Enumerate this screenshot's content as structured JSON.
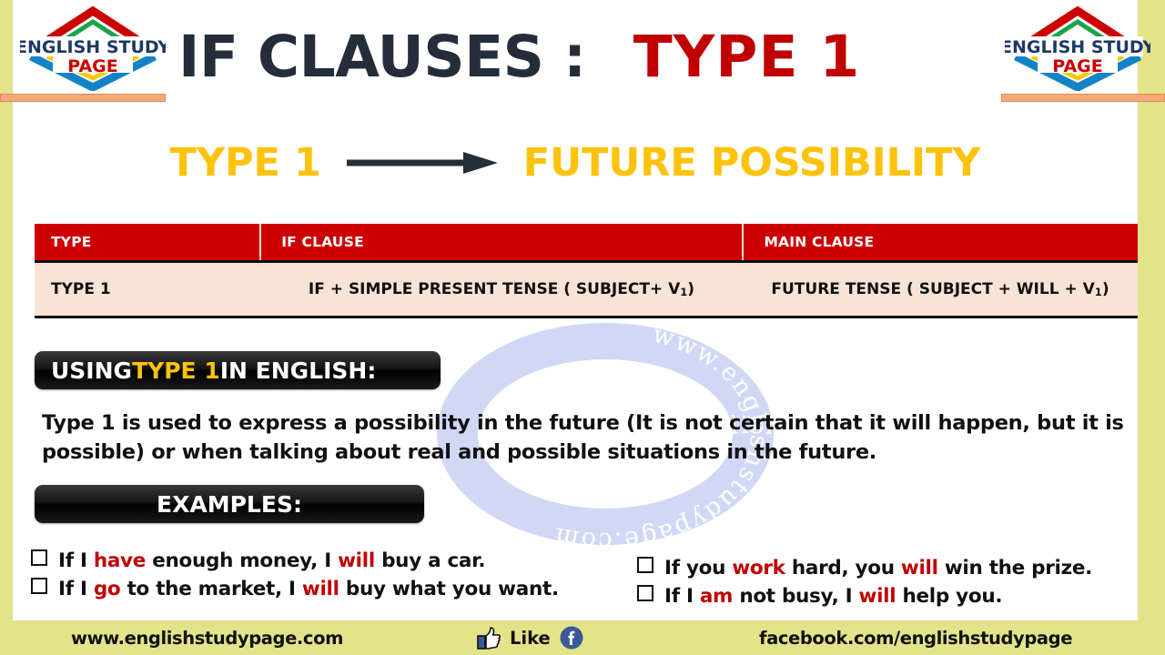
{
  "brand": {
    "logo_line1": "ENGLISH STUDY",
    "logo_line2": "PAGE",
    "watermark_text": "www.englishstudypage.com"
  },
  "header": {
    "title_main": "IF CLAUSES :",
    "title_accent": "TYPE 1",
    "accent_color": "#C00000",
    "title_color": "#252D3A"
  },
  "subtitle": {
    "left_label": "TYPE 1",
    "right_label": "FUTURE POSSIBILITY",
    "arrow_icon": "right-arrow-icon",
    "color": "#FDC20C"
  },
  "table": {
    "header_bg": "#CC0000",
    "body_bg": "#F9E3D7",
    "columns": [
      "TYPE",
      "IF CLAUSE",
      "MAIN CLAUSE"
    ],
    "row": {
      "type": "TYPE  1",
      "if_clause_prefix": "IF + SIMPLE PRESENT TENSE ( SUBJECT+ V",
      "if_clause_sub": "1",
      "if_clause_suffix": " )",
      "main_clause_prefix": "FUTURE TENSE ( SUBJECT + WILL + V",
      "main_clause_sub": "1",
      "main_clause_suffix": " )"
    }
  },
  "using_banner": {
    "part1": "USING ",
    "accent": "TYPE 1",
    "part2": "  IN ENGLISH:"
  },
  "description": "Type 1 is used to express a possibility in the future (It is not certain that it will happen, but it is possible) or when talking about real and possible situations in the future.",
  "examples_banner": {
    "label": "EXAMPLES:"
  },
  "examples": {
    "left": [
      {
        "p1": "If I ",
        "hl1": "have",
        "p2": " enough money, I ",
        "hl2": "will",
        "p3": " buy a car."
      },
      {
        "p1": "If I ",
        "hl1": "go",
        "p2": " to the market, I ",
        "hl2": "will",
        "p3": " buy what you want."
      }
    ],
    "right": [
      {
        "p1": "If you ",
        "hl1": "work",
        "p2": " hard, you ",
        "hl2": "will",
        "p3": " win the prize."
      },
      {
        "p1": "If I ",
        "hl1": "am",
        "p2": " not busy,  I ",
        "hl2": "will",
        "p3": " help you."
      }
    ],
    "highlight_color": "#C00000"
  },
  "footer": {
    "site": "www.englishstudypage.com",
    "like_label": "Like",
    "thumb_icon": "thumbs-up-icon",
    "facebook_icon": "facebook-icon",
    "facebook_page": "facebook.com/englishstudypage",
    "bg_color": "#E3E38A"
  }
}
